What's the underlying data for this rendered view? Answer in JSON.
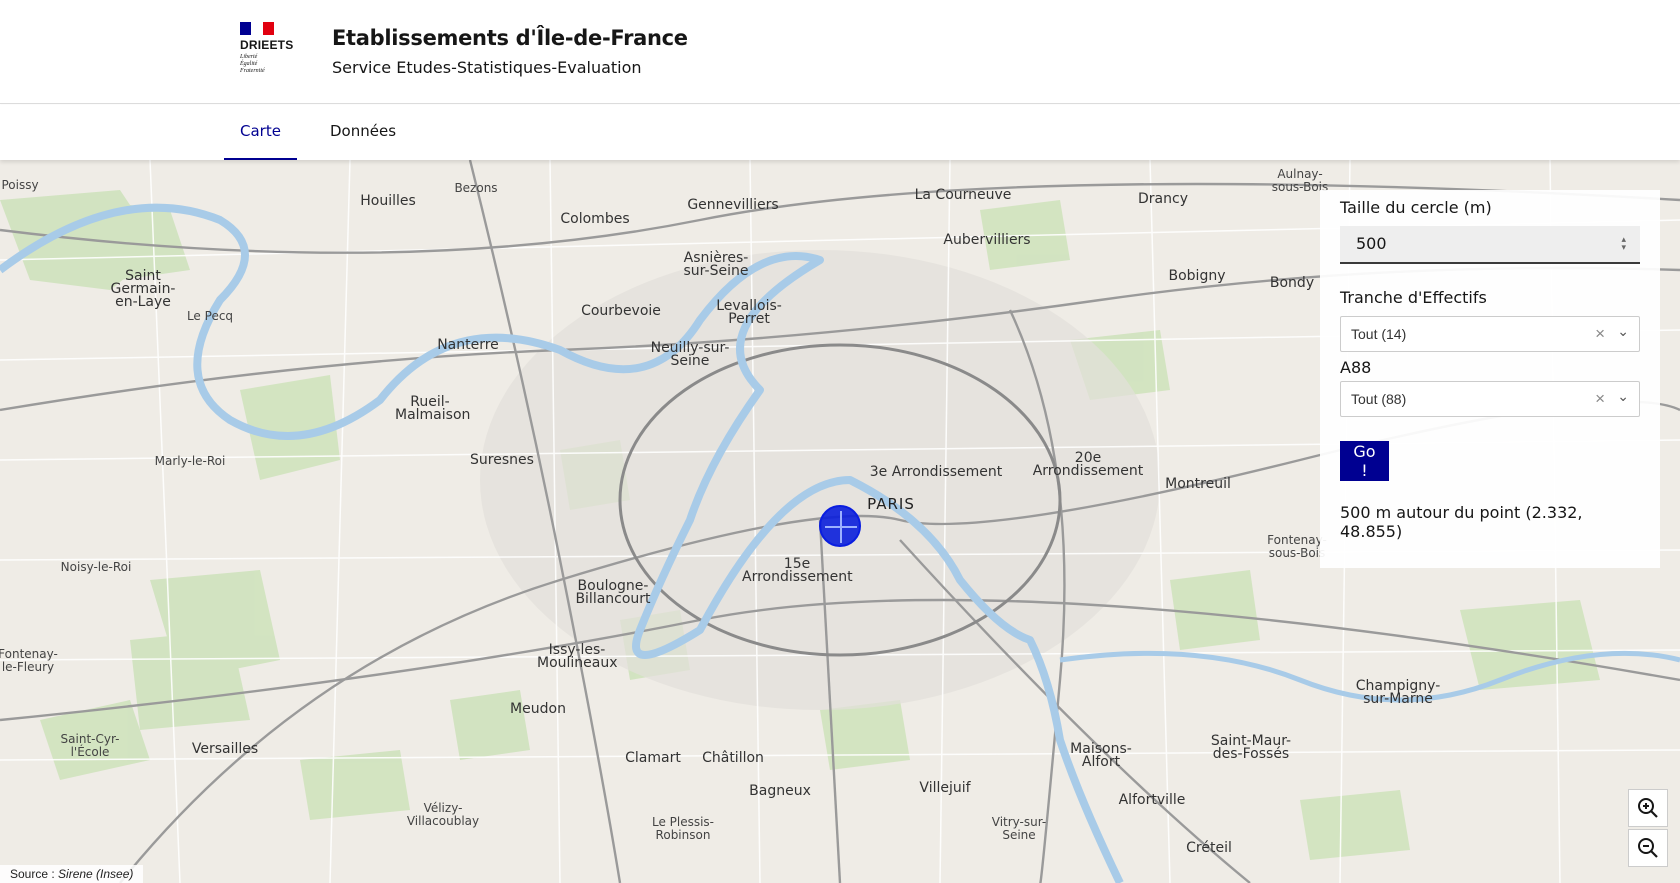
{
  "header": {
    "logo_name": "DRIEETS",
    "logo_motto": [
      "Liberté",
      "Égalité",
      "Fraternité"
    ],
    "title": "Etablissements d'Île-de-France",
    "subtitle": "Service Etudes-Statistiques-Evaluation"
  },
  "nav": {
    "tabs": [
      {
        "label": "Carte",
        "active": true
      },
      {
        "label": "Données",
        "active": false
      }
    ]
  },
  "panel": {
    "circle_label": "Taille du cercle (m)",
    "circle_value": "500",
    "effectifs_label": "Tranche d'Effectifs",
    "effectifs_value": "Tout (14)",
    "a88_label": "A88",
    "a88_value": "Tout (88)",
    "go_label": "Go !",
    "result_text": "500 m autour du point (2.332, 48.855)"
  },
  "map": {
    "source_label": "Source : ",
    "source_name": "Sirene (Insee)",
    "places": [
      {
        "name": "Poissy"
      },
      {
        "name": "Houilles"
      },
      {
        "name": "Bezons"
      },
      {
        "name": "Colombes"
      },
      {
        "name": "Gennevilliers"
      },
      {
        "name": "La Courneuve"
      },
      {
        "name": "Drancy"
      },
      {
        "name": "Aulnay-sous-Bois"
      },
      {
        "name": "Saint Germain-en-Laye"
      },
      {
        "name": "Asnières-sur-Seine"
      },
      {
        "name": "Aubervilliers"
      },
      {
        "name": "Bobigny"
      },
      {
        "name": "Bondy"
      },
      {
        "name": "Courbevoie"
      },
      {
        "name": "Levallois-Perret"
      },
      {
        "name": "Nanterre"
      },
      {
        "name": "Neuilly-sur-Seine"
      },
      {
        "name": "Le Pecq"
      },
      {
        "name": "Rueil-Malmaison"
      },
      {
        "name": "Suresnes"
      },
      {
        "name": "Marly-le-Roi"
      },
      {
        "name": "3e Arrondissement"
      },
      {
        "name": "20e Arrondissement"
      },
      {
        "name": "Montreuil"
      },
      {
        "name": "PARIS"
      },
      {
        "name": "15e Arrondissement"
      },
      {
        "name": "Boulogne-Billancourt"
      },
      {
        "name": "Issy-les-Moulineaux"
      },
      {
        "name": "Fontenay-sous-Bois"
      },
      {
        "name": "Noisy-le-Roi"
      },
      {
        "name": "Meudon"
      },
      {
        "name": "Champigny-sur-Marne"
      },
      {
        "name": "Saint-Maur-des-Fossés"
      },
      {
        "name": "Versailles"
      },
      {
        "name": "Clamart"
      },
      {
        "name": "Châtillon"
      },
      {
        "name": "Bagneux"
      },
      {
        "name": "Villejuif"
      },
      {
        "name": "Maisons-Alfort"
      },
      {
        "name": "Alfortville"
      },
      {
        "name": "Vitry-sur-Seine"
      },
      {
        "name": "Créteil"
      },
      {
        "name": "Le Plessis-Robinson"
      },
      {
        "name": "Vélizy-Villacoublay"
      },
      {
        "name": "Fontenay-le-Fleury"
      },
      {
        "name": "Saint-Cyr-l'École"
      }
    ]
  },
  "colors": {
    "primary": "#000091",
    "marker": "#0a1ee0",
    "flag_blue": "#000091",
    "flag_red": "#e1000f"
  },
  "icons": {
    "zoom_in": "zoom-in-icon",
    "zoom_out": "zoom-out-icon",
    "clear": "close-icon",
    "dropdown": "chevron-down-icon"
  }
}
